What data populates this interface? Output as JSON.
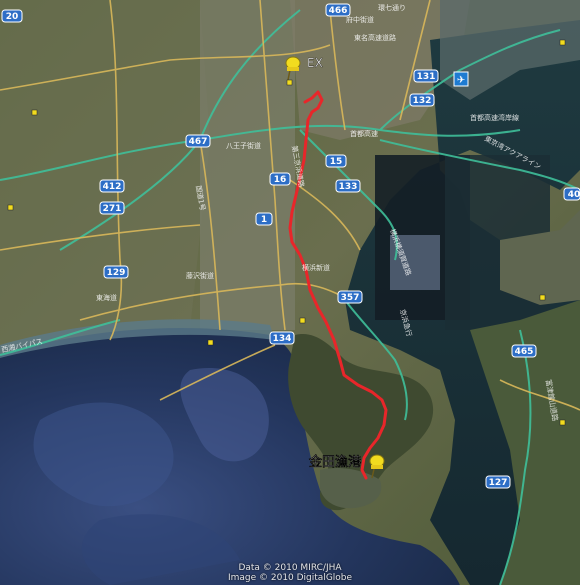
{
  "markers": {
    "start_label": "EX",
    "end_label": "金田漁港"
  },
  "route_color": "#e8262a",
  "road_colors": {
    "expressway": "#3fbf9a",
    "arterial": "#d9b85a"
  },
  "route_shields": [
    "20",
    "466",
    "131",
    "132",
    "467",
    "412",
    "271",
    "16",
    "15",
    "133",
    "1",
    "129",
    "134",
    "357",
    "465",
    "127",
    "40"
  ],
  "road_labels": [
    "東名高速道路",
    "第三京浜道路",
    "首都高速",
    "八王子街道",
    "横浜新道",
    "藤沢街道",
    "国道1号",
    "東海道",
    "横浜横須賀道路",
    "首都高速湾岸線",
    "東京湾アクアライン",
    "府中街道",
    "環七通り",
    "京浜急行",
    "西湘バイパス",
    "富津館山道路"
  ],
  "attribution": {
    "line1": "Data © 2010 MIRC/JHA",
    "line2": "Image © 2010 DigitalGlobe"
  }
}
